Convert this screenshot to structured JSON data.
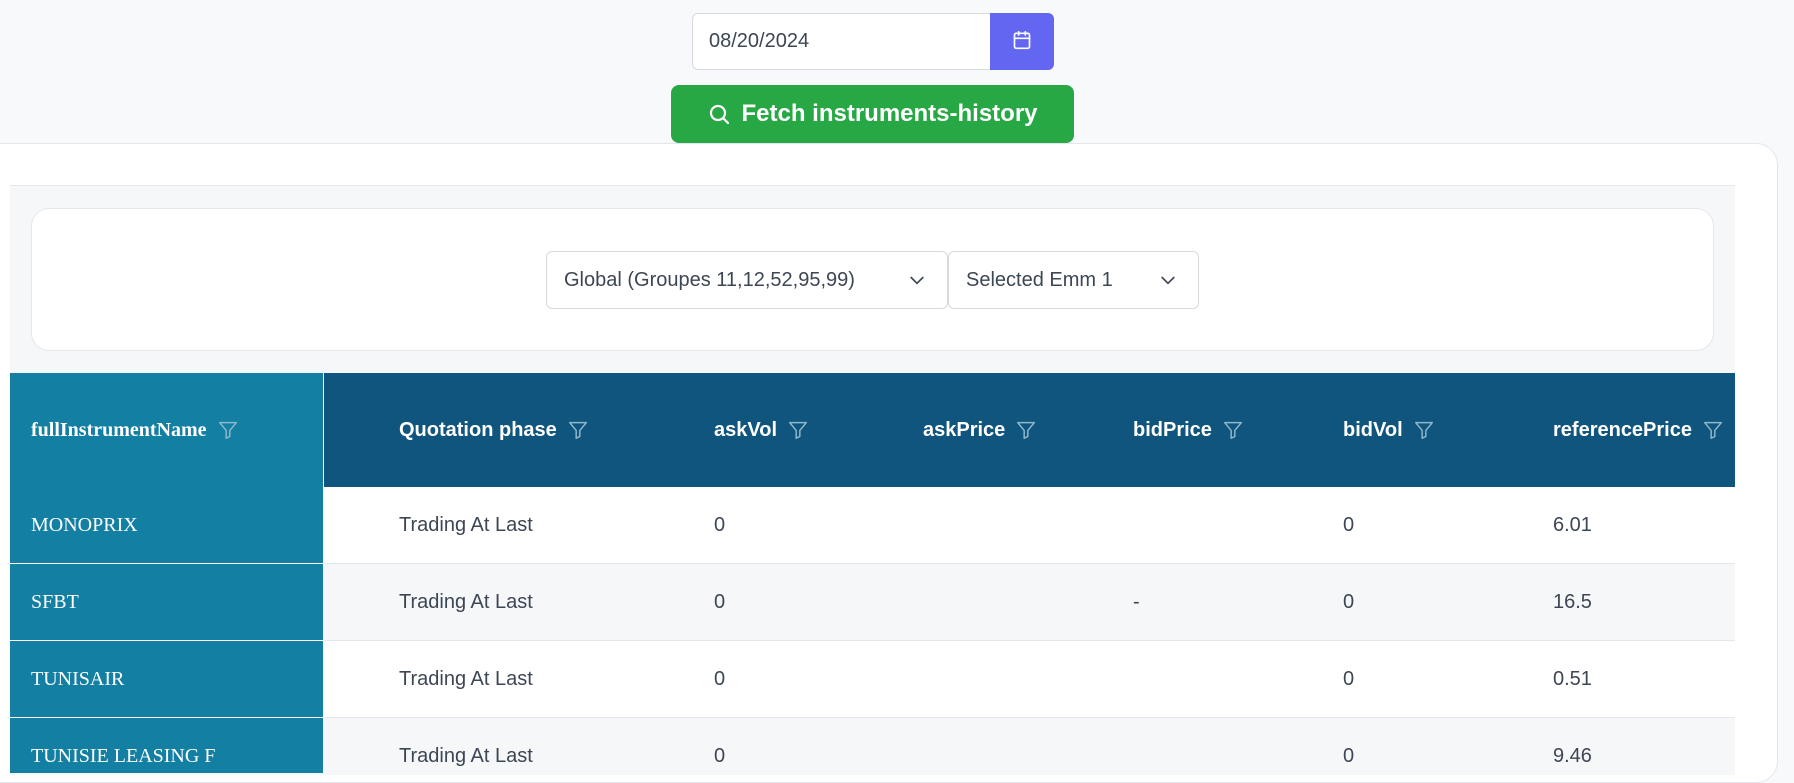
{
  "date_picker": {
    "value": "08/20/2024",
    "icon": "calendar-icon"
  },
  "fetch_button": {
    "label": "Fetch instruments-history",
    "icon": "search-icon",
    "color": "#28a745"
  },
  "filters": {
    "group_select": "Global (Groupes 11,12,52,95,99)",
    "emm_select": "Selected Emm 1"
  },
  "table": {
    "pinned_column_header": "fullInstrumentName",
    "columns": [
      "Quotation phase",
      "askVol",
      "askPrice",
      "bidPrice",
      "bidVol",
      "referencePrice"
    ],
    "rows": [
      {
        "name": "MONOPRIX",
        "phase": "Trading At Last",
        "askVol": "0",
        "askPrice": "",
        "bidPrice": "",
        "bidVol": "0",
        "referencePrice": "6.01"
      },
      {
        "name": "SFBT",
        "phase": "Trading At Last",
        "askVol": "0",
        "askPrice": "",
        "bidPrice": "-",
        "bidVol": "0",
        "referencePrice": "16.5"
      },
      {
        "name": "TUNISAIR",
        "phase": "Trading At Last",
        "askVol": "0",
        "askPrice": "",
        "bidPrice": "",
        "bidVol": "0",
        "referencePrice": "0.51"
      },
      {
        "name": "TUNISIE LEASING F",
        "phase": "Trading At Last",
        "askVol": "0",
        "askPrice": "",
        "bidPrice": "",
        "bidVol": "0",
        "referencePrice": "9.46"
      }
    ]
  },
  "colors": {
    "accent": "#6366f1",
    "header_bg": "#10557e",
    "pinned_bg": "#137fa3"
  }
}
